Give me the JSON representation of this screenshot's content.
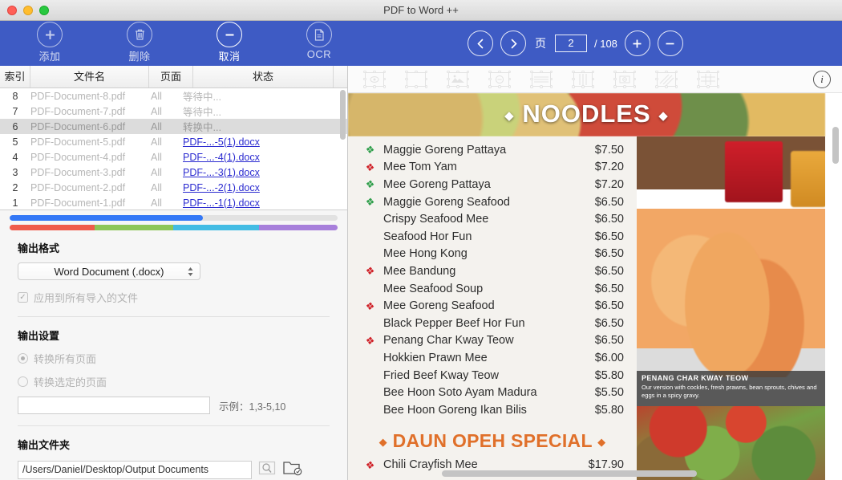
{
  "window": {
    "title": "PDF to Word ++",
    "traffic_lights": [
      "close-red",
      "minimize-yellow",
      "maximize-green"
    ]
  },
  "toolbar": {
    "background": "#3e5bc4",
    "buttons": [
      {
        "label": "添加",
        "icon": "plus-circle-icon",
        "active": false
      },
      {
        "label": "删除",
        "icon": "trash-icon",
        "active": false
      },
      {
        "label": "取消",
        "icon": "minus-circle-icon",
        "active": true
      },
      {
        "label": "OCR",
        "icon": "ocr-document-icon",
        "active": false
      }
    ],
    "page_nav": {
      "prev_icon": "chevron-left-icon",
      "next_icon": "chevron-right-icon",
      "page_label": "页",
      "current_page": "2",
      "total_label": "/ 108",
      "zoom_in_icon": "plus-circle-icon",
      "zoom_out_icon": "minus-circle-icon"
    }
  },
  "file_table": {
    "columns": [
      "索引",
      "文件名",
      "页面",
      "状态"
    ],
    "rows": [
      {
        "index": "1",
        "name": "PDF-Document-1.pdf",
        "pages": "All",
        "status": "PDF-...-1(1).docx",
        "status_is_link": true,
        "selected": false
      },
      {
        "index": "2",
        "name": "PDF-Document-2.pdf",
        "pages": "All",
        "status": "PDF-...-2(1).docx",
        "status_is_link": true,
        "selected": false
      },
      {
        "index": "3",
        "name": "PDF-Document-3.pdf",
        "pages": "All",
        "status": "PDF-...-3(1).docx",
        "status_is_link": true,
        "selected": false
      },
      {
        "index": "4",
        "name": "PDF-Document-4.pdf",
        "pages": "All",
        "status": "PDF-...-4(1).docx",
        "status_is_link": true,
        "selected": false
      },
      {
        "index": "5",
        "name": "PDF-Document-5.pdf",
        "pages": "All",
        "status": "PDF-...-5(1).docx",
        "status_is_link": true,
        "selected": false
      },
      {
        "index": "6",
        "name": "PDF-Document-6.pdf",
        "pages": "All",
        "status": "转换中...",
        "status_is_link": false,
        "selected": true
      },
      {
        "index": "7",
        "name": "PDF-Document-7.pdf",
        "pages": "All",
        "status": "等待中...",
        "status_is_link": false,
        "selected": false
      },
      {
        "index": "8",
        "name": "PDF-Document-8.pdf",
        "pages": "All",
        "status": "等待中...",
        "status_is_link": false,
        "selected": false
      }
    ]
  },
  "progress": {
    "overall_percent": 59,
    "overall_color": "#3478f6",
    "segments": [
      {
        "color": "#ef5b4c",
        "percent": 26
      },
      {
        "color": "#8dc657",
        "percent": 24
      },
      {
        "color": "#43bce4",
        "percent": 26
      },
      {
        "color": "#a77fdb",
        "percent": 24
      }
    ]
  },
  "output_format": {
    "title": "输出格式",
    "selected": "Word Document (.docx)",
    "apply_all_label": "应用到所有导入的文件",
    "apply_all_checked": true
  },
  "output_settings": {
    "title": "输出设置",
    "convert_all_label": "转换所有页面",
    "convert_all_selected": true,
    "convert_selected_label": "转换选定的页面",
    "convert_selected_selected": false,
    "page_range_value": "",
    "example_label": "示例：1,3-5,10"
  },
  "output_folder": {
    "title": "输出文件夹",
    "path": "/Users/Daniel/Desktop/Output Documents",
    "browse_icon": "magnifier-box-icon",
    "open_folder_icon": "folder-check-icon"
  },
  "preview": {
    "region_tools": [
      "region-eye-icon",
      "region-blank-icon",
      "region-image-icon",
      "region-circle-icon",
      "region-rows-icon",
      "region-columns-icon",
      "region-inset-icon",
      "region-hatch-icon",
      "region-table-icon"
    ],
    "info_icon": "info-icon",
    "document": {
      "section_title": "NOODLES",
      "section_diamond": "◆",
      "items": [
        {
          "name": "Maggie Goreng Pattaya",
          "price": "$7.50",
          "chili": "green"
        },
        {
          "name": "Mee Tom Yam",
          "price": "$7.20",
          "chili": "red"
        },
        {
          "name": "Mee Goreng Pattaya",
          "price": "$7.20",
          "chili": "green"
        },
        {
          "name": "Maggie Goreng Seafood",
          "price": "$6.50",
          "chili": "green"
        },
        {
          "name": "Crispy Seafood Mee",
          "price": "$6.50",
          "chili": "none"
        },
        {
          "name": "Seafood Hor Fun",
          "price": "$6.50",
          "chili": "none"
        },
        {
          "name": "Mee Hong Kong",
          "price": "$6.50",
          "chili": "none"
        },
        {
          "name": "Mee Bandung",
          "price": "$6.50",
          "chili": "red"
        },
        {
          "name": "Mee Seafood Soup",
          "price": "$6.50",
          "chili": "none"
        },
        {
          "name": "Mee Goreng Seafood",
          "price": "$6.50",
          "chili": "red"
        },
        {
          "name": "Black Pepper Beef Hor Fun",
          "price": "$6.50",
          "chili": "none"
        },
        {
          "name": "Penang Char Kway Teow",
          "price": "$6.50",
          "chili": "red"
        },
        {
          "name": "Hokkien Prawn Mee",
          "price": "$6.00",
          "chili": "none"
        },
        {
          "name": "Fried Beef Kway Teow",
          "price": "$5.80",
          "chili": "none"
        },
        {
          "name": "Bee Hoon Soto Ayam Madura",
          "price": "$5.50",
          "chili": "none"
        },
        {
          "name": "Bee Hoon Goreng Ikan Bilis",
          "price": "$5.80",
          "chili": "none"
        }
      ],
      "second_section_title": "DAUN OPEH SPECIAL",
      "second_section_items": [
        {
          "name": "Chili Crayfish Mee",
          "price": "$17.90",
          "chili": "red"
        }
      ],
      "photo_caption_title": "PENANG CHAR KWAY TEOW",
      "photo_caption_desc": "Our version with cockles, fresh prawns, bean sprouts, chives and eggs in a spicy gravy."
    }
  }
}
